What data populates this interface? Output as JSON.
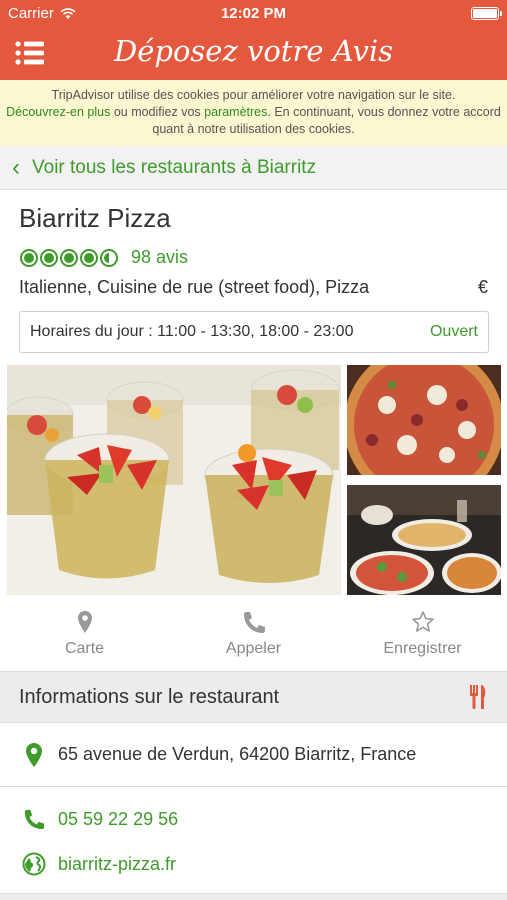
{
  "status_bar": {
    "carrier": "Carrier",
    "time": "12:02 PM"
  },
  "nav": {
    "title": "Déposez votre Avis",
    "menu_icon": "hamburger-menu-icon"
  },
  "cookie_notice": {
    "line1": "TripAdvisor utilise des cookies pour améliorer votre navigation sur le site.",
    "link_more": "Découvrez-en plus",
    "mid": " ou modifiez vos ",
    "link_settings": "paramètres",
    "rest": ". En continuant, vous donnez votre accord quant à notre utilisation des cookies."
  },
  "back_link": "Voir tous les restaurants à Biarritz",
  "restaurant": {
    "name": "Biarritz Pizza",
    "rating": 4.5,
    "reviews": "98 avis",
    "cuisine": "Italienne, Cuisine de rue (street food), Pizza",
    "price": "€",
    "hours_label": "Horaires du jour : 11:00 - 13:30, 18:00 - 23:00",
    "open_status": "Ouvert"
  },
  "actions": [
    {
      "label": "Carte",
      "icon": "map-pin-icon"
    },
    {
      "label": "Appeler",
      "icon": "phone-icon"
    },
    {
      "label": "Enregistrer",
      "icon": "star-icon"
    }
  ],
  "info_section": {
    "title": "Informations sur le restaurant",
    "icon": "fork-knife-icon"
  },
  "contact": {
    "address": "65 avenue de Verdun, 64200 Biarritz, France",
    "phone": "05 59 22 29 56",
    "website": "biarritz-pizza.fr"
  },
  "colors": {
    "brand": "#e4583e",
    "green": "#3f9b2c",
    "cookie_bg": "#fbf7d1"
  }
}
